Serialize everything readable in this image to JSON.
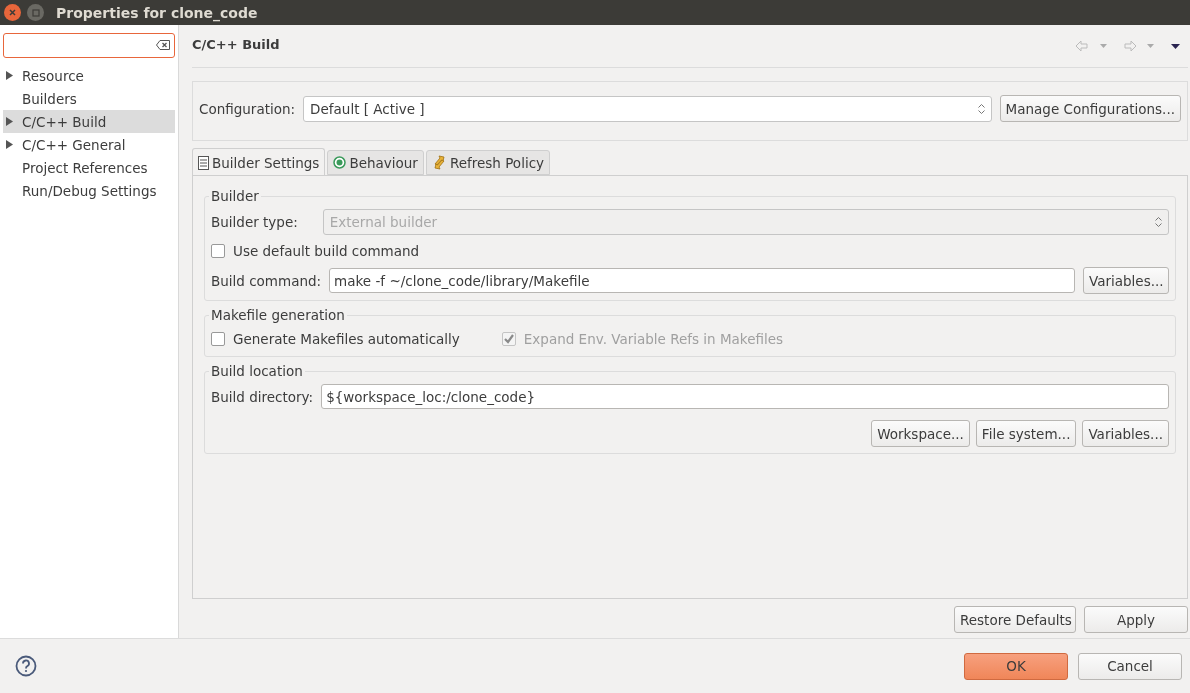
{
  "window": {
    "title": "Properties for clone_code"
  },
  "sidebar": {
    "items": [
      {
        "label": "Resource",
        "expandable": true,
        "selected": false
      },
      {
        "label": "Builders",
        "expandable": false,
        "selected": false
      },
      {
        "label": "C/C++ Build",
        "expandable": true,
        "selected": true
      },
      {
        "label": "C/C++ General",
        "expandable": true,
        "selected": false
      },
      {
        "label": "Project References",
        "expandable": false,
        "selected": false
      },
      {
        "label": "Run/Debug Settings",
        "expandable": false,
        "selected": false
      }
    ]
  },
  "page": {
    "title": "C/C++ Build",
    "configuration": {
      "label": "Configuration:",
      "value": "Default  [ Active ]",
      "button": "Manage Configurations..."
    },
    "tabs": [
      {
        "label": "Builder Settings",
        "selected": true
      },
      {
        "label": "Behaviour",
        "selected": false
      },
      {
        "label": "Refresh Policy",
        "selected": false
      }
    ],
    "builder": {
      "title": "Builder",
      "type_label": "Builder type:",
      "type_value": "External builder",
      "type_disabled": true,
      "default_command": {
        "label": "Use default build command",
        "checked": false,
        "disabled": false
      },
      "command_label": "Build command:",
      "command_value": "make -f ~/clone_code/library/Makefile",
      "variables_button": "Variables..."
    },
    "makefile": {
      "title": "Makefile generation",
      "options": [
        {
          "label": "Generate Makefiles automatically",
          "checked": false,
          "disabled": false
        },
        {
          "label": "Expand Env. Variable Refs in Makefiles",
          "checked": true,
          "disabled": true
        }
      ]
    },
    "location": {
      "title": "Build location",
      "directory_label": "Build directory:",
      "directory_value": "${workspace_loc:/clone_code}",
      "buttons": [
        "Workspace...",
        "File system...",
        "Variables..."
      ]
    },
    "buttons": [
      "Restore Defaults",
      "Apply"
    ]
  },
  "footer": {
    "buttons": [
      {
        "label": "OK",
        "default": true
      },
      {
        "label": "Cancel",
        "default": false
      }
    ]
  }
}
